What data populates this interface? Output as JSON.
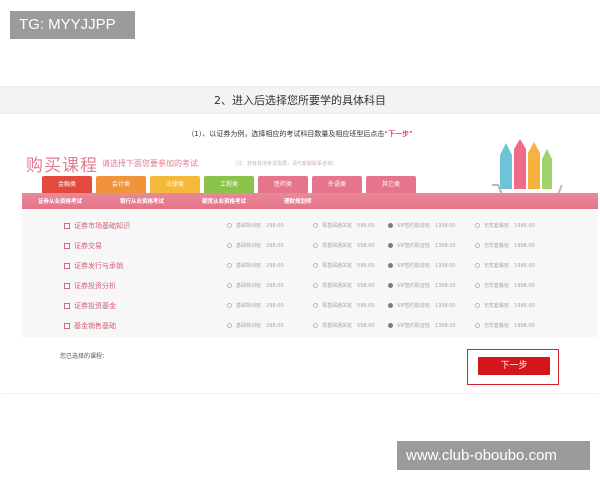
{
  "watermarks": {
    "top_left": "TG: MYYJJPP",
    "bottom_right": "www.club-oboubo.com"
  },
  "step": {
    "text": "2、进入后选择您所要学的具体科目"
  },
  "intro": {
    "prefix": "（1）、以证券为例，选择相应的考试科目数量及相应班型后点击",
    "highlight": "“下一步”"
  },
  "banner": {
    "title": "购买课程",
    "subtitle": "请选择下面您要参加的考试",
    "note": "（注：若有其他考试需要，请与客服联系咨询）"
  },
  "tabs": [
    {
      "label": "金融类",
      "color": "#e5493d"
    },
    {
      "label": "会计类",
      "color": "#f19439"
    },
    {
      "label": "法律类",
      "color": "#f4b83a"
    },
    {
      "label": "工程类",
      "color": "#8bc34a"
    },
    {
      "label": "医药类",
      "color": "#e6748a"
    },
    {
      "label": "外语类",
      "color": "#e6748a"
    },
    {
      "label": "其它类",
      "color": "#e6748a"
    }
  ],
  "subnav": [
    "证券从业资格考试",
    "银行从业资格考试",
    "期货从业资格考试",
    "理财规划师"
  ],
  "option_labels": [
    "基础特训班",
    "零基础通关班",
    "VIP签约取证班",
    "无忧套餐班"
  ],
  "option_prices": [
    "298.00",
    "598.00",
    "1398.00",
    "1998.00"
  ],
  "courses": [
    {
      "name": "证券市场基础知识"
    },
    {
      "name": "证券交易"
    },
    {
      "name": "证券发行与承销"
    },
    {
      "name": "证券投资分析"
    },
    {
      "name": "证券投资基金"
    },
    {
      "name": "基金销售基础"
    }
  ],
  "selected_courses_label": "您已选择的课程：",
  "next_button": "下一步"
}
